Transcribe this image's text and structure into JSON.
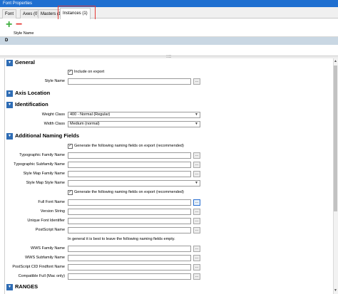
{
  "window": {
    "title": "Font Properties"
  },
  "tabs": [
    {
      "label": "Font"
    },
    {
      "label": "Axes (0)"
    },
    {
      "label": "Masters (1)"
    },
    {
      "label": "Instances (1)"
    }
  ],
  "toolbar": {
    "add_icon": "plus-icon",
    "remove_icon": "minus-icon",
    "add_color": "#3fae3f",
    "remove_color": "#e53935"
  },
  "instances_grid": {
    "column_header": "Style Name",
    "rows": [
      {
        "style_name": "D"
      }
    ]
  },
  "sections": {
    "general": {
      "title": "General",
      "include_on_export": "Include on export",
      "style_name_label": "Style Name",
      "style_name_value": ""
    },
    "axis_location": {
      "title": "Axis Location"
    },
    "identification": {
      "title": "Identification",
      "weight_class_label": "Weight Class",
      "weight_class_value": "400 - Normal (Regular)",
      "width_class_label": "Width Class",
      "width_class_value": "Medium (normal)"
    },
    "naming": {
      "title": "Additional Naming Fields",
      "generate_label_1": "Generate the following naming fields on export (recommended)",
      "typo_family_label": "Typographic Family Name",
      "typo_subfamily_label": "Typographic Subfamily Name",
      "style_map_family_label": "Style Map Family Name",
      "style_map_style_label": "Style Map Style Name",
      "generate_label_2": "Generate the following naming fields on export (recommended)",
      "full_font_name_label": "Full Font Name",
      "version_string_label": "Version String",
      "unique_font_id_label": "Unique Font Identifier",
      "postscript_name_label": "PostScript Name",
      "empty_note": "In general it is best to leave the following naming fields empty.",
      "wws_family_label": "WWS Family Name",
      "wws_subfamily_label": "WWS Subfamily Name",
      "ps_cid_label": "PostScript CID Findfont Name",
      "compat_full_label": "Compatible Full (Mac only)"
    },
    "next_section_partial": {
      "title": "RANGES"
    }
  },
  "button_ellipsis": "..."
}
